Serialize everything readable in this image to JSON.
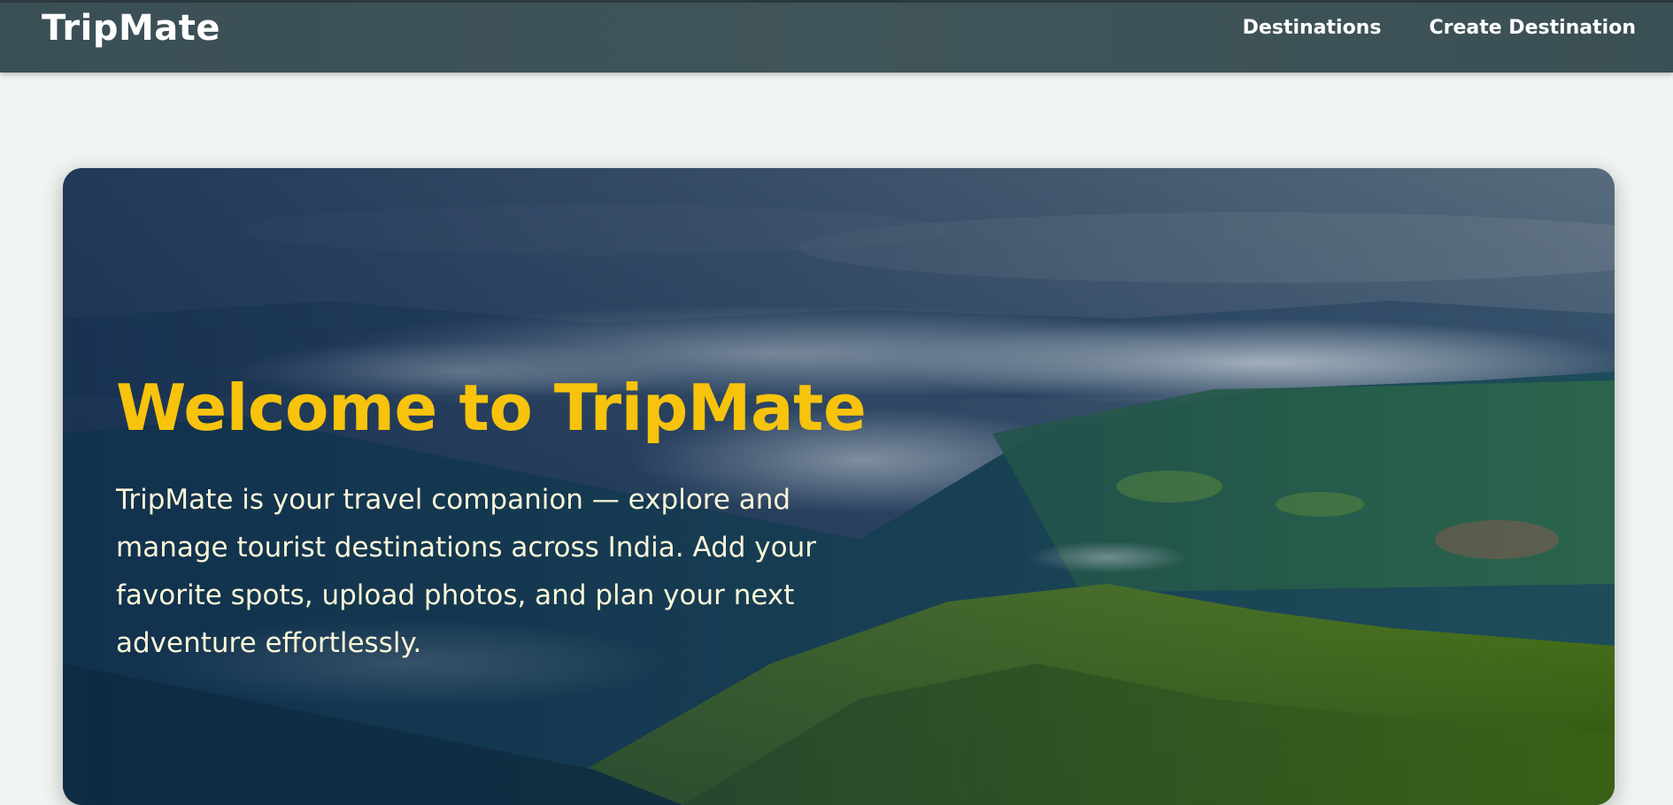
{
  "navbar": {
    "brand": "TripMate",
    "links": [
      {
        "label": "Destinations"
      },
      {
        "label": "Create Destination"
      }
    ]
  },
  "hero": {
    "title": "Welcome to TripMate",
    "description": "TripMate is your travel companion — explore and manage tourist destinations across India. Add your favorite spots, upload photos, and plan your next adventure effortlessly."
  },
  "colors": {
    "navbar": "#3f5357",
    "page_background": "#f1f5f1",
    "title": "#f7c30c",
    "body_text": "#fbf6d8"
  }
}
